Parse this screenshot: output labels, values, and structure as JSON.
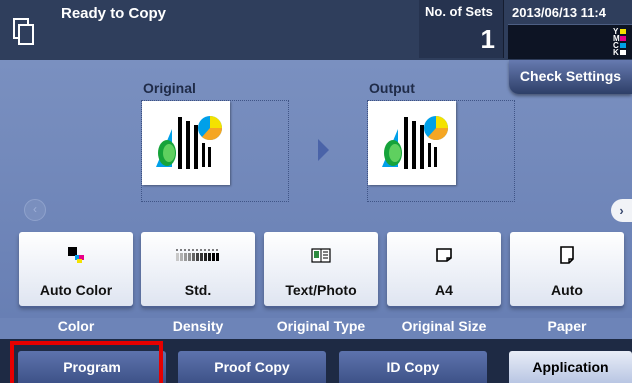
{
  "header": {
    "status": "Ready to Copy",
    "sets_label": "No. of Sets",
    "sets_value": "1",
    "datetime": "2013/06/13 11:4",
    "toner": [
      {
        "label": "Y",
        "color": "#f4e200"
      },
      {
        "label": "M",
        "color": "#e8008a"
      },
      {
        "label": "C",
        "color": "#00a0e9"
      },
      {
        "label": "K",
        "color": "#ffffff"
      }
    ]
  },
  "check_settings": "Check Settings",
  "preview": {
    "original_label": "Original",
    "output_label": "Output"
  },
  "functions": [
    {
      "value": "Auto Color",
      "caption": "Color",
      "icon": "auto-color-icon"
    },
    {
      "value": "Std.",
      "caption": "Density",
      "icon": "density-scale-icon"
    },
    {
      "value": "Text/Photo",
      "caption": "Original Type",
      "icon": "text-photo-icon"
    },
    {
      "value": "A4",
      "caption": "Original Size",
      "icon": "paper-size-icon"
    },
    {
      "value": "Auto",
      "caption": "Paper",
      "icon": "paper-tray-icon"
    }
  ],
  "tabs": [
    {
      "label": "Program",
      "active": false
    },
    {
      "label": "Proof Copy",
      "active": false
    },
    {
      "label": "ID Copy",
      "active": false
    },
    {
      "label": "Application",
      "active": true
    }
  ],
  "colors": {
    "header_bg": "#2f3e5c",
    "panel_bg": "#6d84b8",
    "highlight": "#e60000"
  }
}
